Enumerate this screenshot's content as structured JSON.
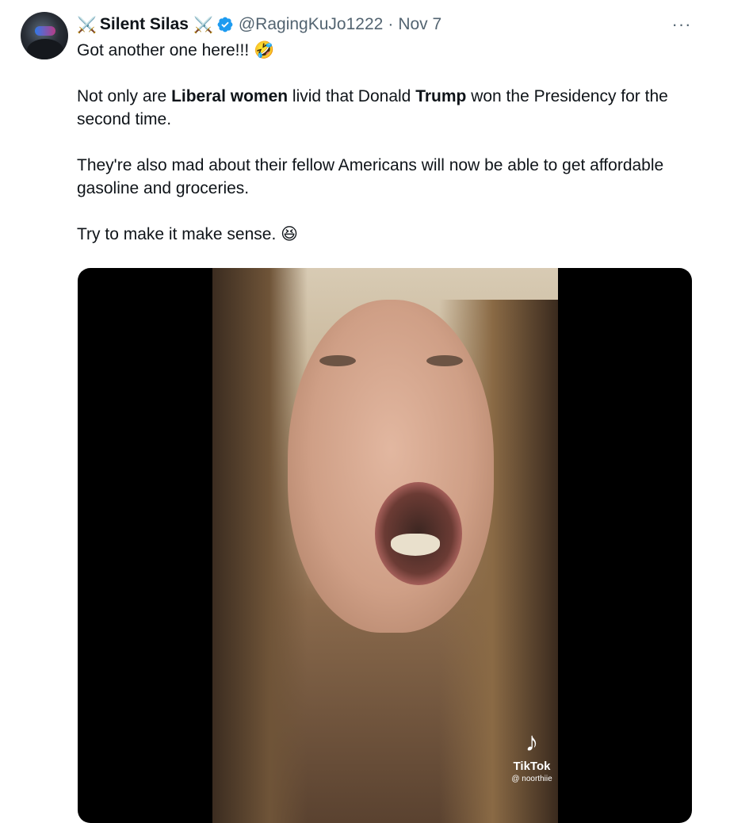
{
  "tweet": {
    "author": {
      "display_name": "Silent Silas",
      "name_prefix_emoji": "⚔️",
      "name_suffix_emoji": "⚔️",
      "handle": "@RagingKuJo1222",
      "separator": "·",
      "date": "Nov 7",
      "verified": true,
      "verified_color": "#1d9bf0"
    },
    "more_label": "···",
    "text": {
      "line1": "Got another one here!!! 🤣",
      "p2_a": "Not only are ",
      "p2_bold1": "Liberal women",
      "p2_b": " livid that Donald ",
      "p2_bold2": "Trump",
      "p2_c": " won the Presidency for the second time.",
      "p3": "They're also mad about their fellow Americans will now be able to get affordable gasoline and groceries.",
      "p4": "Try to make it make sense. 😆"
    },
    "media": {
      "type": "video",
      "watermark_icon": "tiktok-logo-icon",
      "watermark_brand": "TikTok",
      "watermark_user": "@ noorthiie"
    }
  }
}
